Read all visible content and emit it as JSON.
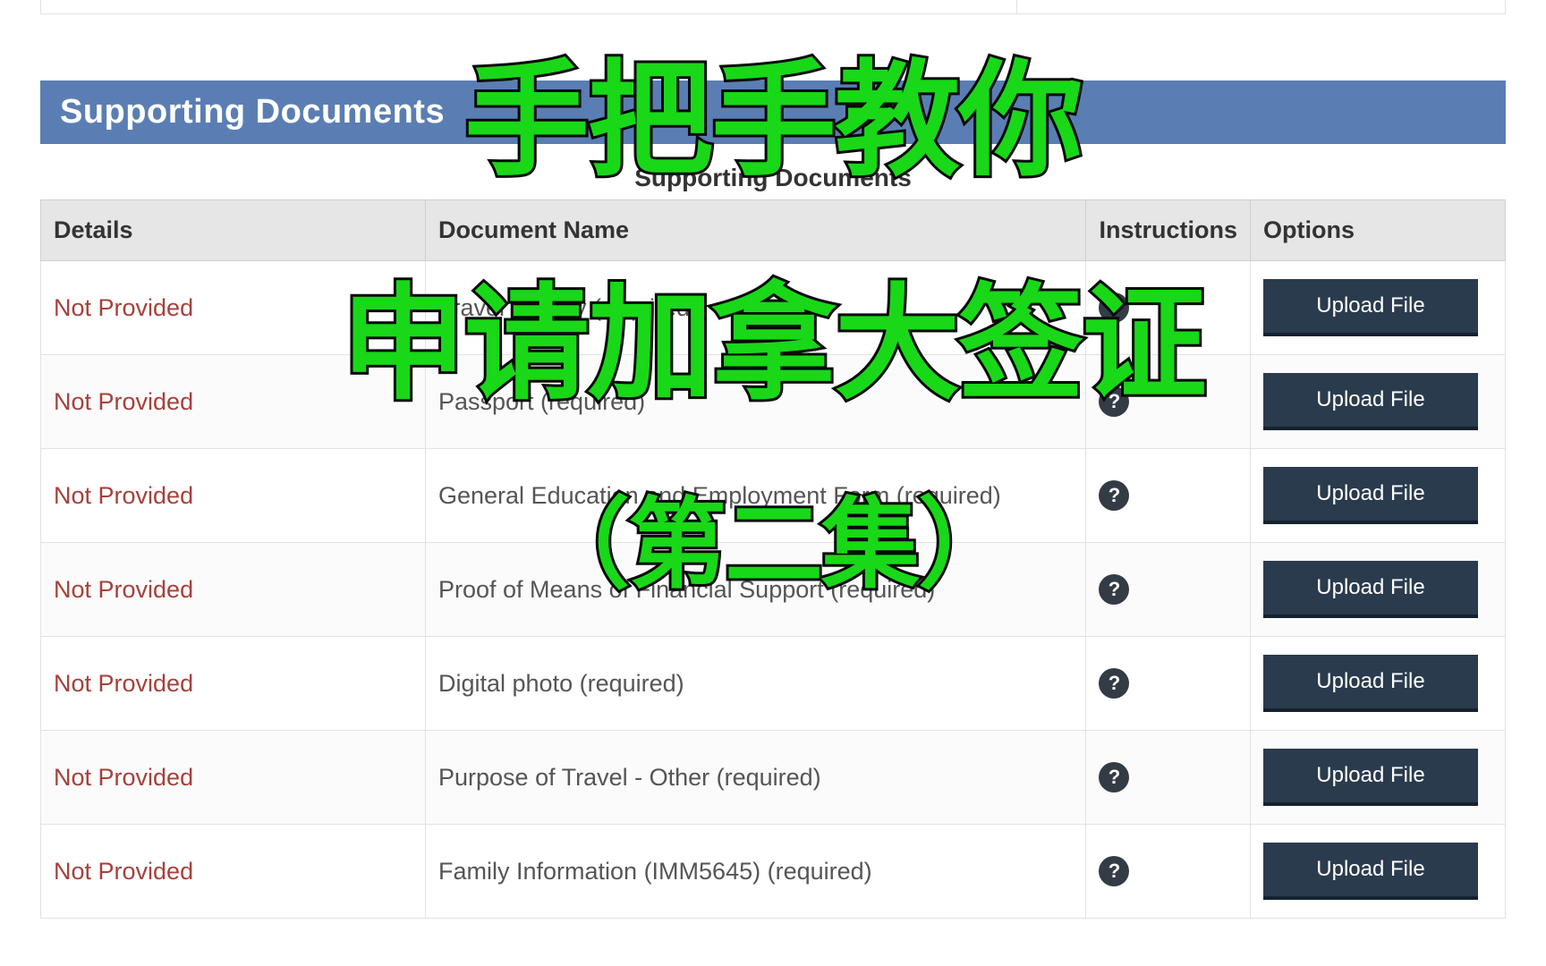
{
  "section": {
    "title": "Supporting Documents"
  },
  "table": {
    "caption": "Supporting Documents",
    "headers": {
      "details": "Details",
      "docname": "Document Name",
      "instructions": "Instructions",
      "options": "Options"
    },
    "help_icon_char": "?",
    "upload_label": "Upload File",
    "rows": [
      {
        "details": "Not Provided",
        "docname": "Travel History  (required)"
      },
      {
        "details": "Not Provided",
        "docname": "Passport  (required)"
      },
      {
        "details": "Not Provided",
        "docname": "General Education and Employment Form  (required)"
      },
      {
        "details": "Not Provided",
        "docname": "Proof of Means of Financial Support  (required)"
      },
      {
        "details": "Not Provided",
        "docname": "Digital photo  (required)"
      },
      {
        "details": "Not Provided",
        "docname": "Purpose of Travel - Other  (required)"
      },
      {
        "details": "Not Provided",
        "docname": "Family Information (IMM5645)  (required)"
      }
    ]
  },
  "overlay": {
    "line1": "手把手教你",
    "line2": "申请加拿大签证",
    "line3": "（第二集）"
  }
}
